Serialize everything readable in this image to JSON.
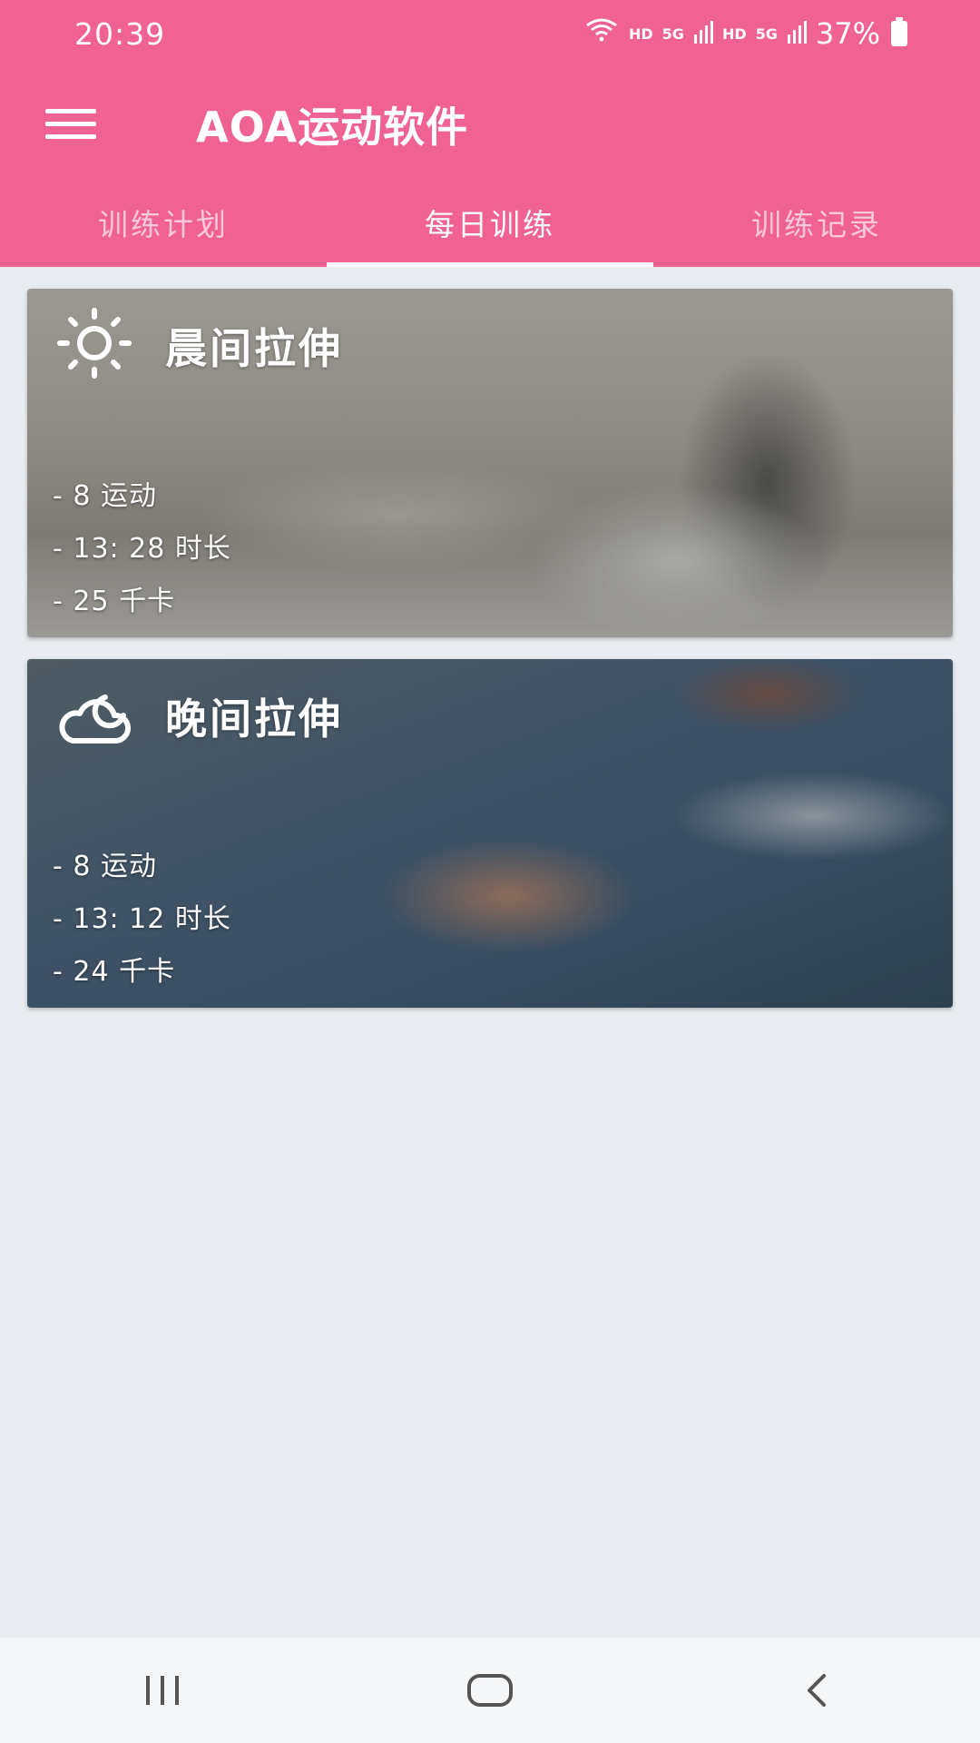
{
  "status_bar": {
    "time": "20:39",
    "network_label_1": "HD",
    "network_gen_1": "5G",
    "network_label_2": "HD",
    "network_gen_2": "5G",
    "battery": "37%",
    "icons": [
      "wifi-icon",
      "signal-icon",
      "signal-icon",
      "battery-icon"
    ]
  },
  "toolbar": {
    "title": "AOA运动软件",
    "menu_icon": "hamburger-menu-icon"
  },
  "tabs": [
    {
      "label": "训练计划",
      "active": false
    },
    {
      "label": "每日训练",
      "active": true
    },
    {
      "label": "训练记录",
      "active": false
    }
  ],
  "cards": [
    {
      "icon": "sun-icon",
      "title": "晨间拉伸",
      "exercises": "- 8 运动",
      "duration": "- 13: 28 时长",
      "calories": "- 25 千卡"
    },
    {
      "icon": "cloud-moon-icon",
      "title": "晚间拉伸",
      "exercises": "- 8 运动",
      "duration": "- 13: 12 时长",
      "calories": "- 24 千卡"
    }
  ],
  "navbar": {
    "icons": [
      "recent-apps-icon",
      "home-icon",
      "back-icon"
    ]
  },
  "colors": {
    "primary": "#f06292",
    "background": "#e8ecf0",
    "navbar": "#f5f6f7"
  }
}
